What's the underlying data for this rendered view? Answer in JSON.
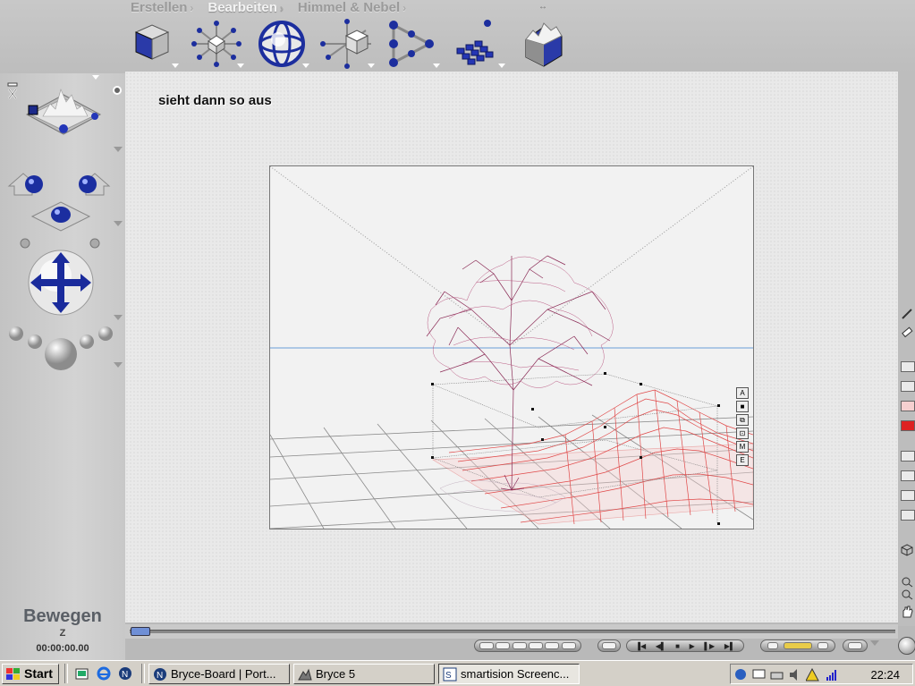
{
  "app": {
    "tabs": [
      {
        "label": "Erstellen",
        "active": false
      },
      {
        "label": "Bearbeiten",
        "active": true
      },
      {
        "label": "Himmel & Nebel",
        "active": false
      }
    ],
    "tab_nav_glyph": "↔",
    "palette_tools": [
      {
        "name": "select-cube-tool",
        "icon": "cube-icon"
      },
      {
        "name": "resize-tool",
        "icon": "resize-icon"
      },
      {
        "name": "rotate-tool",
        "icon": "rotate-sphere-icon"
      },
      {
        "name": "reposition-tool",
        "icon": "reposition-icon"
      },
      {
        "name": "align-tool",
        "icon": "align-icon"
      },
      {
        "name": "randomize-tool",
        "icon": "randomize-icon"
      },
      {
        "name": "terrain-editor-tool",
        "icon": "terrain-icon"
      }
    ]
  },
  "left_panel": {
    "mode_label": "Bewegen",
    "axis_label": "Z",
    "time": "00:00:00.00"
  },
  "canvas": {
    "caption": "sieht dann so aus",
    "scene_tools": [
      "A",
      "■",
      "⧉",
      "⊡",
      "M",
      "E"
    ]
  },
  "taskbar": {
    "start_label": "Start",
    "tasks": [
      {
        "label": "Bryce-Board | Port...",
        "active": false
      },
      {
        "label": "Bryce 5",
        "active": false
      },
      {
        "label": "smartision Screenc...",
        "active": true
      }
    ],
    "clock": "22:24"
  },
  "colors": {
    "accent_blue": "#2233aa",
    "tree": "#8a2a55",
    "terrain": "#e04848",
    "horizon": "#6a9fd8"
  }
}
